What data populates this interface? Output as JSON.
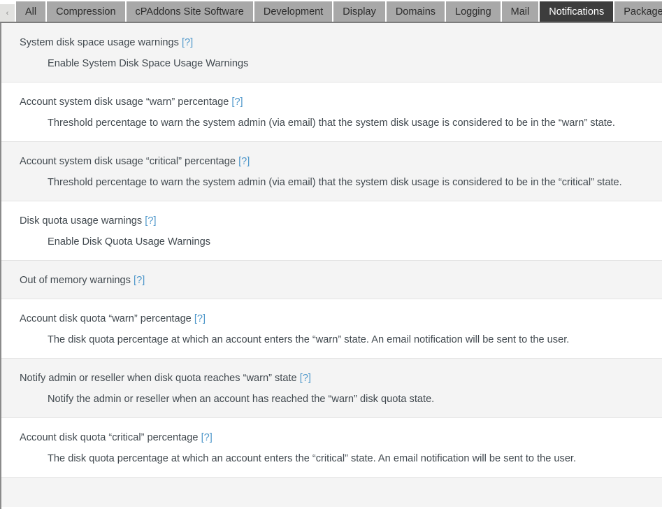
{
  "tabbar": {
    "scroll_left_icon": "chevron-left-icon",
    "scroll_left_label": "‹",
    "tabs": [
      {
        "label": "All",
        "active": false
      },
      {
        "label": "Compression",
        "active": false
      },
      {
        "label": "cPAddons Site Software",
        "active": false
      },
      {
        "label": "Development",
        "active": false
      },
      {
        "label": "Display",
        "active": false
      },
      {
        "label": "Domains",
        "active": false
      },
      {
        "label": "Logging",
        "active": false
      },
      {
        "label": "Mail",
        "active": false
      },
      {
        "label": "Notifications",
        "active": true
      },
      {
        "label": "Packages",
        "active": false
      }
    ]
  },
  "help_label": "[?]",
  "settings": [
    {
      "title": "System disk space usage warnings",
      "help": "[?]",
      "desc": "Enable System Disk Space Usage Warnings",
      "shaded": true
    },
    {
      "title": "Account system disk usage “warn” percentage",
      "help": "[?]",
      "desc": "Threshold percentage to warn the system admin (via email) that the system disk usage is considered to be in the “warn” state.",
      "shaded": false
    },
    {
      "title": "Account system disk usage “critical” percentage",
      "help": "[?]",
      "desc": "Threshold percentage to warn the system admin (via email) that the system disk usage is considered to be in the “critical” state.",
      "shaded": true
    },
    {
      "title": "Disk quota usage warnings",
      "help": "[?]",
      "desc": "Enable Disk Quota Usage Warnings",
      "shaded": false
    },
    {
      "title": "Out of memory warnings",
      "help": "[?]",
      "desc": "",
      "shaded": true
    },
    {
      "title": "Account disk quota “warn” percentage",
      "help": "[?]",
      "desc": "The disk quota percentage at which an account enters the “warn” state. An email notification will be sent to the user.",
      "shaded": false
    },
    {
      "title": "Notify admin or reseller when disk quota reaches “warn” state",
      "help": "[?]",
      "desc": "Notify the admin or reseller when an account has reached the “warn” disk quota state.",
      "shaded": true
    },
    {
      "title": "Account disk quota “critical” percentage",
      "help": "[?]",
      "desc": "The disk quota percentage at which an account enters the “critical” state. An email notification will be sent to the user.",
      "shaded": false
    },
    {
      "title": "",
      "help": "",
      "desc": "",
      "shaded": true
    }
  ],
  "colors": {
    "tab_inactive_bg": "#a8a8a8",
    "tab_active_bg": "#3d3d3d",
    "tab_active_text": "#ffffff",
    "row_shaded_bg": "#f4f4f4",
    "row_plain_bg": "#ffffff",
    "text": "#41494f",
    "help_link": "#4e97ca",
    "panel_border": "#8b8b8b"
  }
}
